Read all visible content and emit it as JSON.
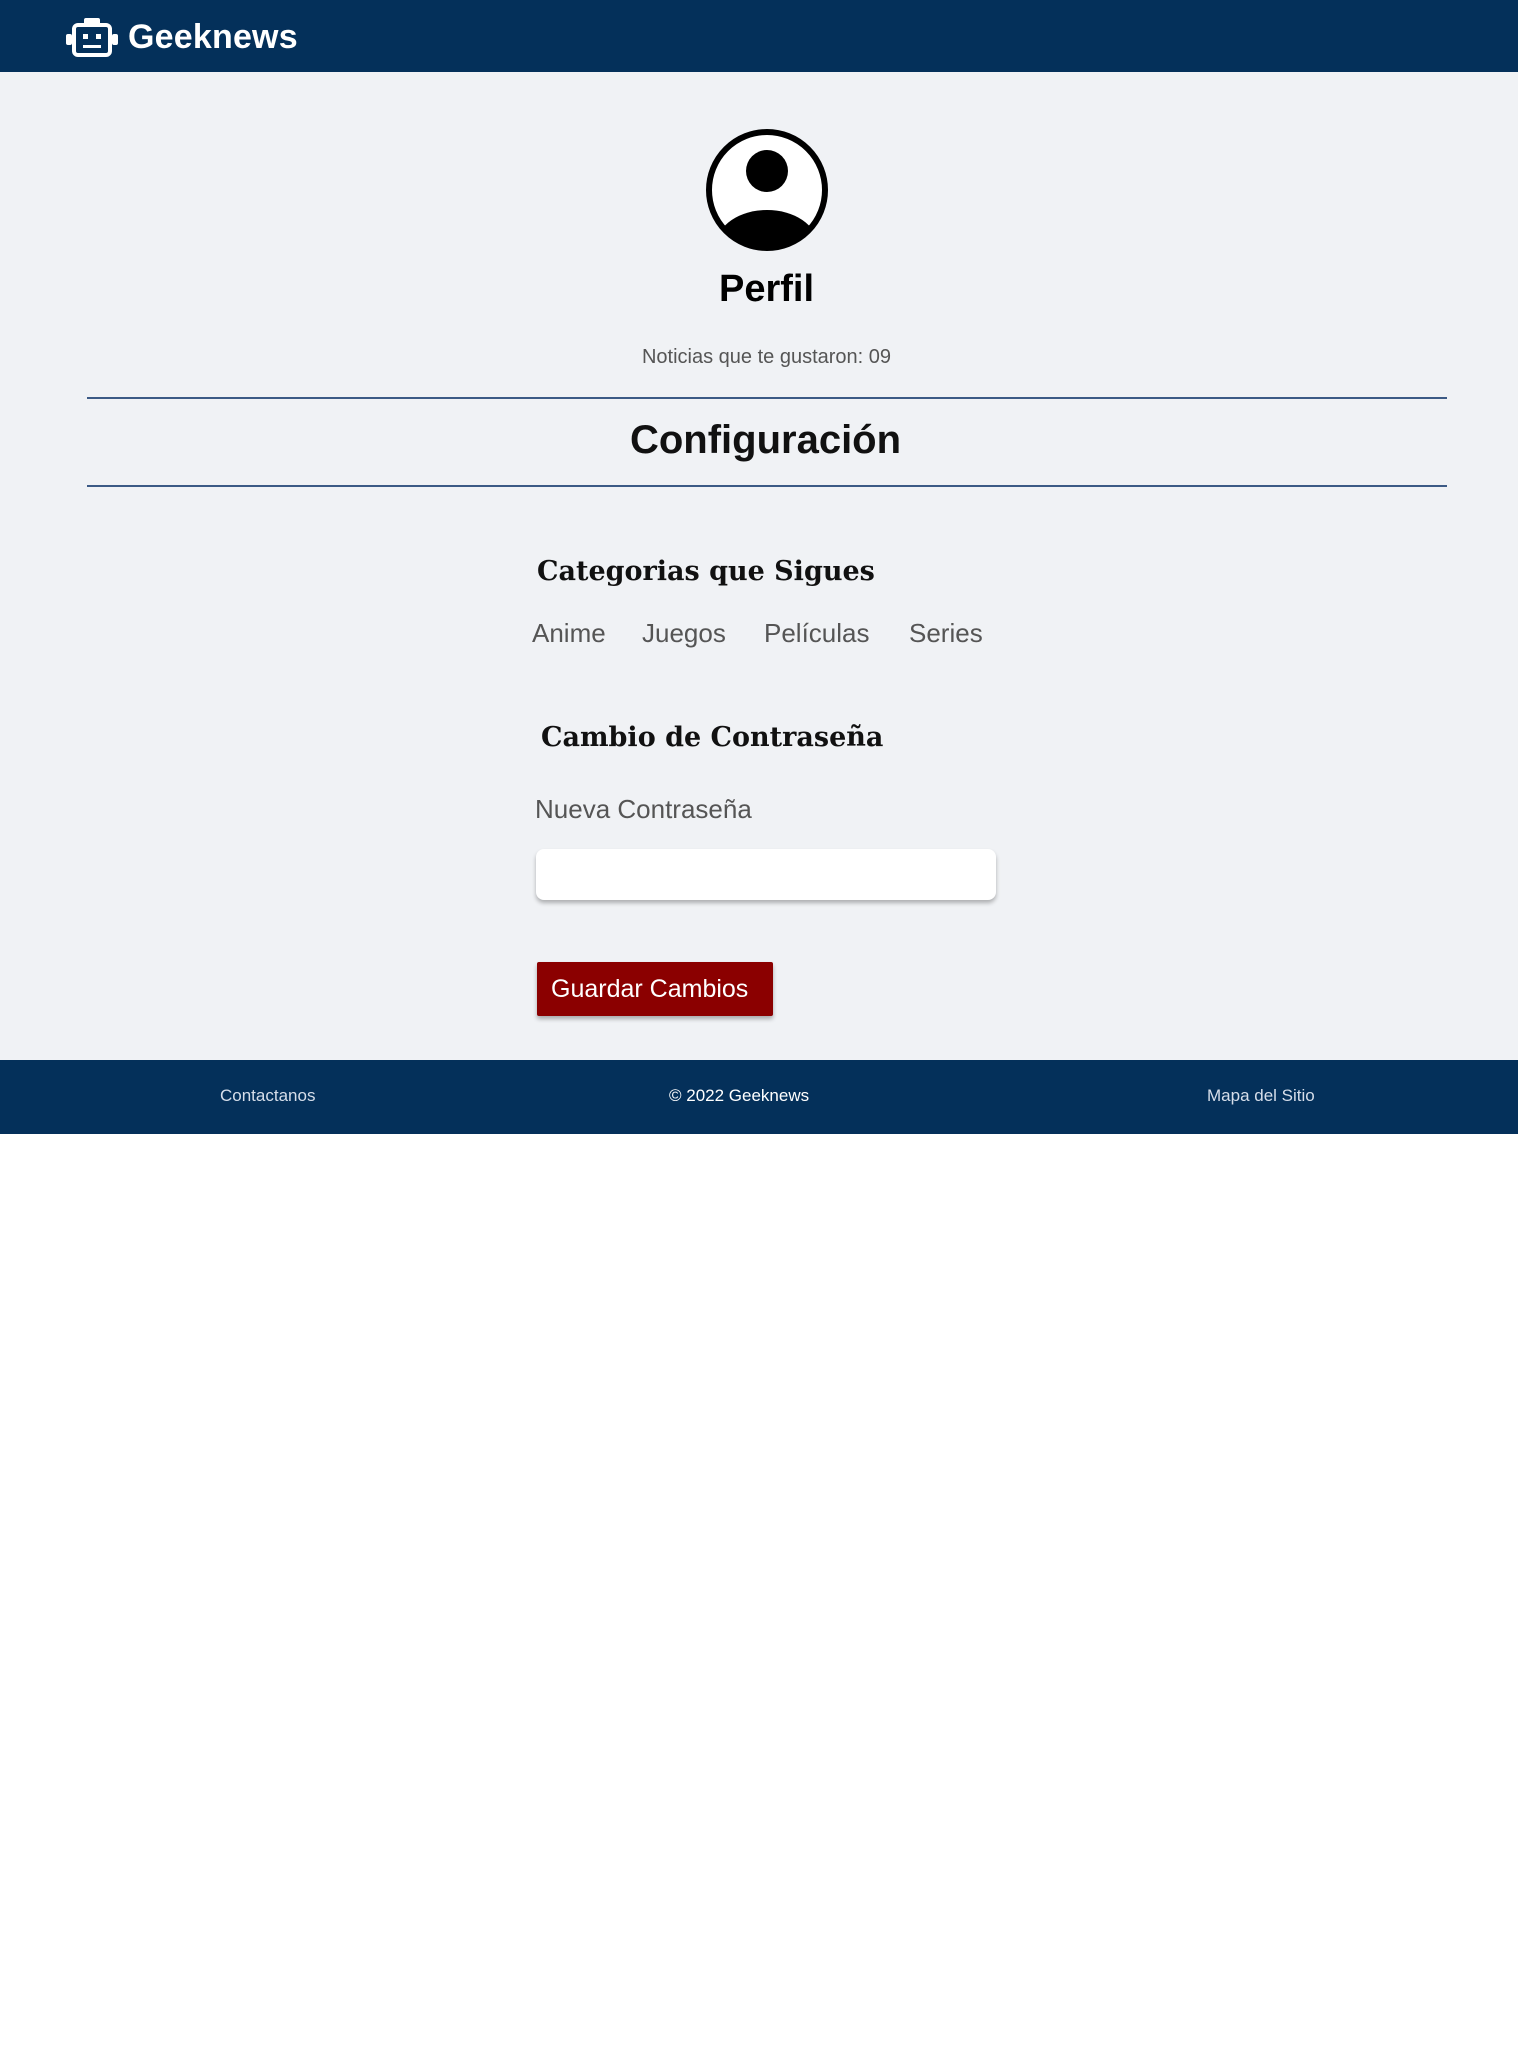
{
  "header": {
    "brand": "Geeknews",
    "brand_icon": "robot-icon"
  },
  "profile": {
    "avatar_icon": "user-circle-icon",
    "title": "Perfil",
    "liked_news": "Noticias que te gustaron: 09"
  },
  "config": {
    "title": "Configuración",
    "categories_title": "Categorias que Sigues",
    "categories": [
      "Anime",
      "Juegos",
      "Películas",
      "Series"
    ],
    "password_title": "Cambio de Contraseña",
    "password_label": "Nueva Contraseña",
    "password_value": "",
    "save_label": "Guardar Cambios"
  },
  "footer": {
    "contact": "Contactanos",
    "copyright": "© 2022 Geeknews",
    "sitemap": "Mapa del Sitio"
  },
  "colors": {
    "header_bg": "#04305a",
    "page_bg": "#f0f2f5",
    "button_bg": "#8b0000",
    "divider": "#3c5a85"
  }
}
